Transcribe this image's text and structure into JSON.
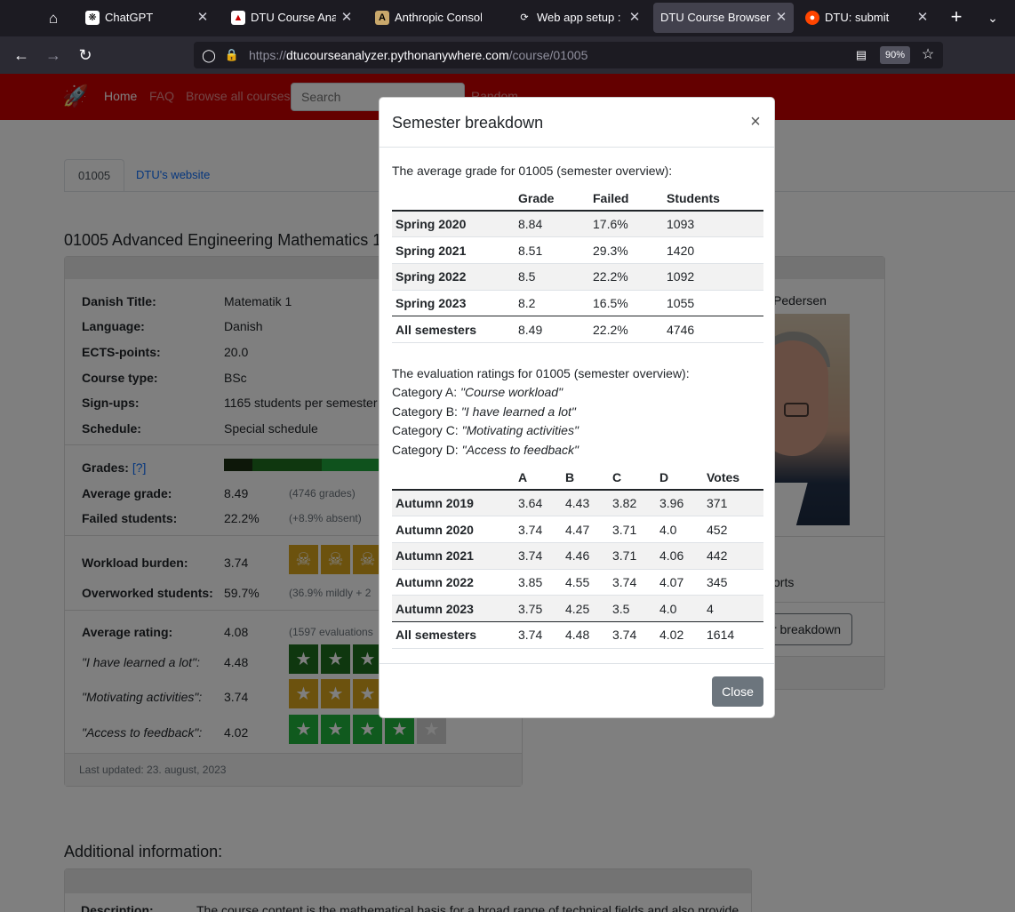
{
  "browser": {
    "tabs": [
      {
        "title": "ChatGPT",
        "icon": "chatgpt-icon"
      },
      {
        "title": "DTU Course Analyze",
        "icon": "dtu-analyzer-icon"
      },
      {
        "title": "Anthropic Console",
        "icon": "anthropic-icon"
      },
      {
        "title": "Web app setup : DTU",
        "icon": "pythonanywhere-icon"
      },
      {
        "title": "DTU Course Browser",
        "icon": "none",
        "active": true
      },
      {
        "title": "DTU: submit",
        "icon": "reddit-icon"
      }
    ],
    "url_prefix": "https://",
    "url_host": "dtucourseanalyzer.pythonanywhere.com",
    "url_path": "/course/01005",
    "zoom": "90%"
  },
  "site": {
    "nav": {
      "home": "Home",
      "faq": "FAQ",
      "browse": "Browse all courses",
      "search_placeholder": "Search",
      "random": "Random"
    },
    "tabs": {
      "course": "01005",
      "website": "DTU's website"
    },
    "course_title": "01005 Advanced Engineering Mathematics 1",
    "details": [
      {
        "key": "Danish Title:",
        "value": "Matematik 1"
      },
      {
        "key": "Language:",
        "value": "Danish"
      },
      {
        "key": "ECTS-points:",
        "value": "20.0"
      },
      {
        "key": "Course type:",
        "value": "BSc"
      },
      {
        "key": "Sign-ups:",
        "value": "1165 students per semester"
      },
      {
        "key": "Schedule:",
        "value": "Special schedule"
      }
    ],
    "grades_label": "Grades:",
    "grades_help": "[?]",
    "average_grade": {
      "key": "Average grade:",
      "value": "8.49",
      "note": "(4746 grades)"
    },
    "failed": {
      "key": "Failed students:",
      "value": "22.2%",
      "note": "(+8.9% absent)"
    },
    "workload": {
      "key": "Workload burden:",
      "value": "3.74"
    },
    "overworked": {
      "key": "Overworked students:",
      "value": "59.7%",
      "note": "(36.9% mildly + 2"
    },
    "avg_rating": {
      "key": "Average rating:",
      "value": "4.08",
      "note": "(1597 evaluations"
    },
    "ratings": [
      {
        "key": "\"I have learned a lot\":",
        "value": "4.48"
      },
      {
        "key": "\"Motivating activities\":",
        "value": "3.74"
      },
      {
        "key": "\"Access to feedback\":",
        "value": "4.02"
      }
    ],
    "last_updated": "Last updated: 23. august, 2023",
    "teacher_name": "Pedersen",
    "reports_text": "orts",
    "breakdown_button": "r breakdown",
    "additional_title": "Additional information:",
    "description_key": "Description:",
    "description_value": "The course content is the mathematical basis for a broad range of technical fields and also provides"
  },
  "modal": {
    "title": "Semester breakdown",
    "close_x": "×",
    "grade_intro": "The average grade for 01005 (semester overview):",
    "grade_headers": [
      "",
      "Grade",
      "Failed",
      "Students"
    ],
    "grade_rows": [
      [
        "Spring 2020",
        "8.84",
        "17.6%",
        "1093"
      ],
      [
        "Spring 2021",
        "8.51",
        "29.3%",
        "1420"
      ],
      [
        "Spring 2022",
        "8.5",
        "22.2%",
        "1092"
      ],
      [
        "Spring 2023",
        "8.2",
        "16.5%",
        "1055"
      ]
    ],
    "grade_total": [
      "All semesters",
      "8.49",
      "22.2%",
      "4746"
    ],
    "eval_intro": "The evaluation ratings for 01005 (semester overview):",
    "categories": [
      {
        "label": "Category A:",
        "text": "\"Course workload\""
      },
      {
        "label": "Category B:",
        "text": "\"I have learned a lot\""
      },
      {
        "label": "Category C:",
        "text": "\"Motivating activities\""
      },
      {
        "label": "Category D:",
        "text": "\"Access to feedback\""
      }
    ],
    "eval_headers": [
      "",
      "A",
      "B",
      "C",
      "D",
      "Votes"
    ],
    "eval_rows": [
      [
        "Autumn 2019",
        "3.64",
        "4.43",
        "3.82",
        "3.96",
        "371"
      ],
      [
        "Autumn 2020",
        "3.74",
        "4.47",
        "3.71",
        "4.0",
        "452"
      ],
      [
        "Autumn 2021",
        "3.74",
        "4.46",
        "3.71",
        "4.06",
        "442"
      ],
      [
        "Autumn 2022",
        "3.85",
        "4.55",
        "3.74",
        "4.07",
        "345"
      ],
      [
        "Autumn 2023",
        "3.75",
        "4.25",
        "3.5",
        "4.0",
        "4"
      ]
    ],
    "eval_total": [
      "All semesters",
      "3.74",
      "4.48",
      "3.74",
      "4.02",
      "1614"
    ],
    "close_button": "Close"
  },
  "colors": {
    "site_red": "#c80000",
    "dark_green": "#1e6e1e",
    "gold": "#d8a41c",
    "bright_green": "#20b43c",
    "close_grey": "#6c757d"
  }
}
